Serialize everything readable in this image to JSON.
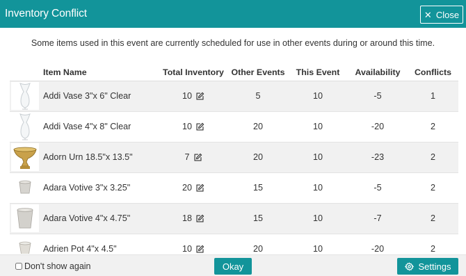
{
  "dialog": {
    "title": "Inventory Conflict",
    "close_label": "Close",
    "message": "Some items used in this event are currently scheduled for use in other events during or around this time."
  },
  "table": {
    "headers": {
      "name": "Item Name",
      "total": "Total Inventory",
      "other": "Other Events",
      "this": "This Event",
      "availability": "Availability",
      "conflicts": "Conflicts"
    },
    "rows": [
      {
        "thumb": "vase-tall-thumb",
        "name": "Addi Vase 3\"x 6\" Clear",
        "total": "10",
        "other": "5",
        "this": "10",
        "availability": "-5",
        "conflicts": "1"
      },
      {
        "thumb": "vase-tall-thumb",
        "name": "Addi Vase 4\"x 8\" Clear",
        "total": "10",
        "other": "20",
        "this": "10",
        "availability": "-20",
        "conflicts": "2"
      },
      {
        "thumb": "urn-gold-thumb",
        "name": "Adorn Urn 18.5\"x 13.5\"",
        "total": "7",
        "other": "20",
        "this": "10",
        "availability": "-23",
        "conflicts": "2"
      },
      {
        "thumb": "votive-thumb",
        "name": "Adara Votive 3\"x 3.25\"",
        "total": "20",
        "other": "15",
        "this": "10",
        "availability": "-5",
        "conflicts": "2"
      },
      {
        "thumb": "votive-large-thumb",
        "name": "Adara Votive 4\"x 4.75\"",
        "total": "18",
        "other": "15",
        "this": "10",
        "availability": "-7",
        "conflicts": "2"
      },
      {
        "thumb": "pot-thumb",
        "name": "Adrien Pot 4\"x 4.5\"",
        "total": "10",
        "other": "20",
        "this": "10",
        "availability": "-20",
        "conflicts": "2"
      }
    ]
  },
  "footer": {
    "dont_show_label": "Don't show again",
    "dont_show_checked": false,
    "okay_label": "Okay",
    "settings_label": "Settings"
  },
  "colors": {
    "accent": "#12949a",
    "row_alt": "#f1f1f1"
  },
  "icons": {
    "close": "close-icon",
    "edit": "edit-icon",
    "settings": "gear-icon"
  }
}
